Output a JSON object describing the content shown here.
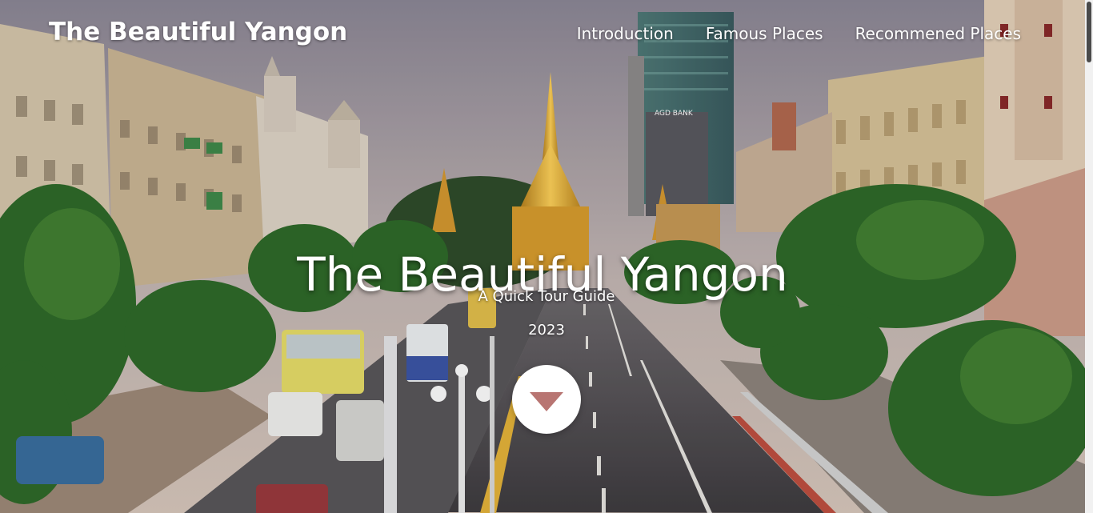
{
  "navbar": {
    "brand": "The Beautiful Yangon",
    "links": [
      {
        "label": "Introduction"
      },
      {
        "label": "Famous Places"
      },
      {
        "label": "Recommened Places"
      }
    ]
  },
  "hero": {
    "title": "The Beautiful Yangon",
    "subtitle": "A Quick Tour Guide",
    "year": "2023",
    "background_photo_sign": "AGD BANK",
    "scroll_button_icon": "chevron-down-icon"
  },
  "colors": {
    "scroll_arrow": "#b87572",
    "sky_top": "#8f8a98",
    "sky_bottom": "#d3c7c0",
    "pagoda_gold": "#e8b33a"
  }
}
